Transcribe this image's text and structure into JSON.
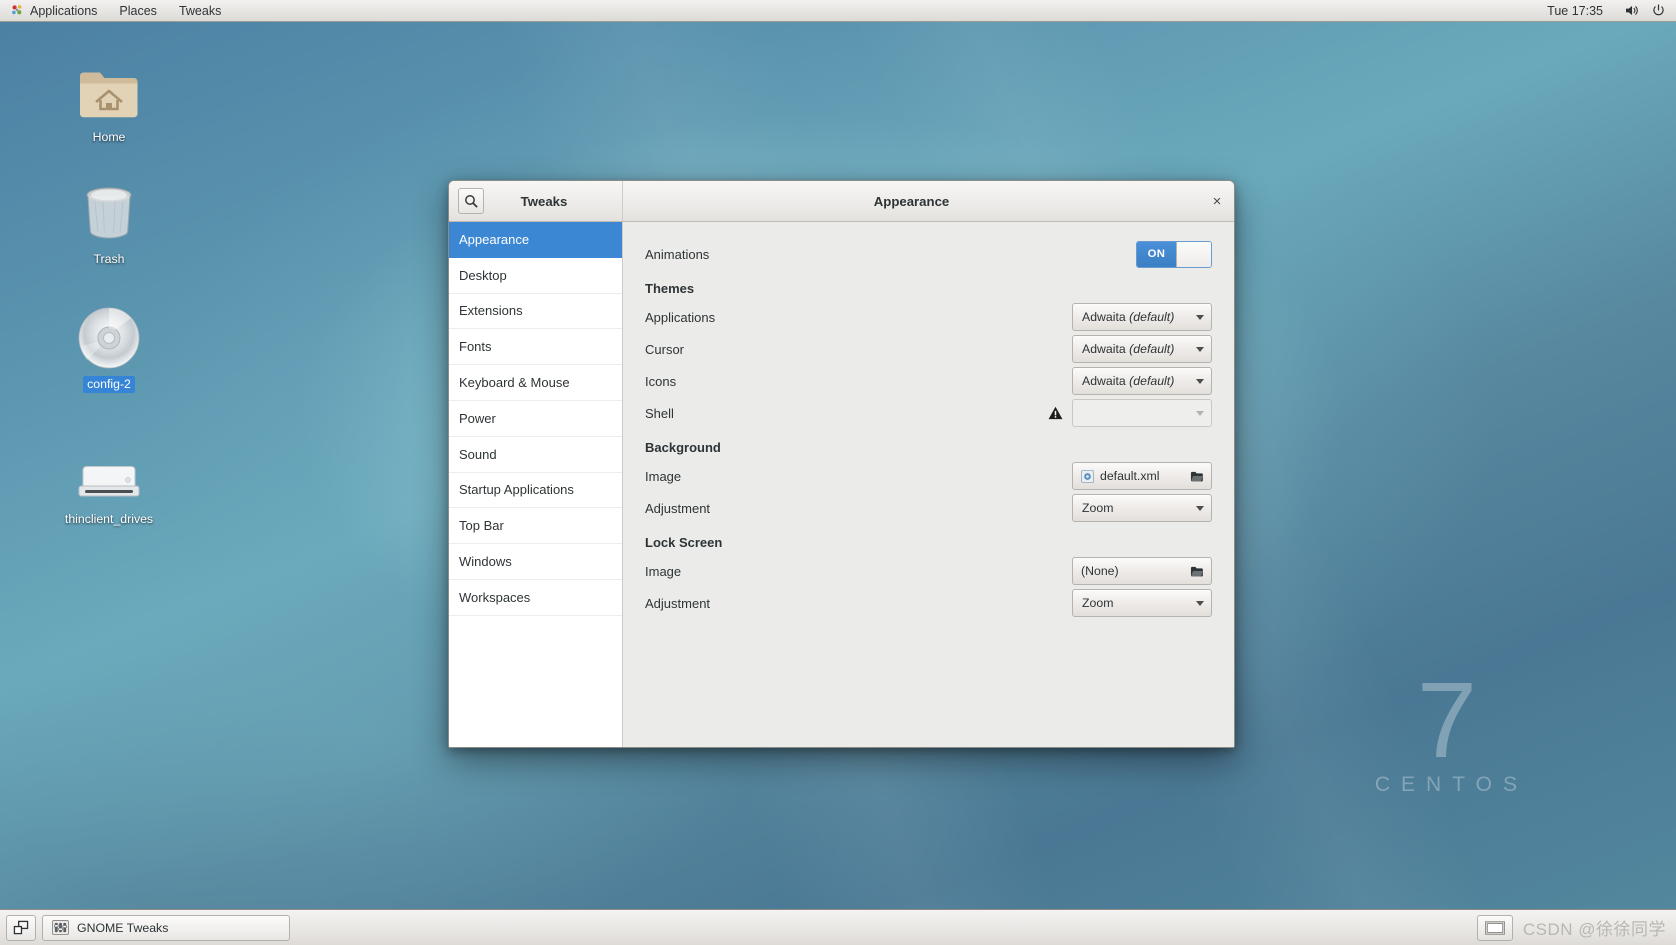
{
  "topbar": {
    "activities_label": "Applications",
    "places_label": "Places",
    "app_label": "Tweaks",
    "clock": "Tue 17:35",
    "volume_icon": "speaker-icon",
    "power_icon": "power-icon",
    "gnome_icon": "gnome-logo-icon"
  },
  "desktop": {
    "icons": [
      {
        "label": "Home",
        "icon": "home-folder-icon",
        "selected": false
      },
      {
        "label": "Trash",
        "icon": "trash-icon",
        "selected": false
      },
      {
        "label": "config-2",
        "icon": "cdrom-icon",
        "selected": true
      },
      {
        "label": "thinclient_drives",
        "icon": "drive-icon",
        "selected": false
      }
    ],
    "wallpaper_mark": {
      "number": "7",
      "word": "CENTOS"
    }
  },
  "window": {
    "title": "Tweaks",
    "subtitle": "Appearance",
    "search_icon": "search-icon",
    "close_label": "×",
    "sidebar": [
      {
        "label": "Appearance",
        "active": true
      },
      {
        "label": "Desktop",
        "active": false
      },
      {
        "label": "Extensions",
        "active": false
      },
      {
        "label": "Fonts",
        "active": false
      },
      {
        "label": "Keyboard & Mouse",
        "active": false
      },
      {
        "label": "Power",
        "active": false
      },
      {
        "label": "Sound",
        "active": false
      },
      {
        "label": "Startup Applications",
        "active": false
      },
      {
        "label": "Top Bar",
        "active": false
      },
      {
        "label": "Windows",
        "active": false
      },
      {
        "label": "Workspaces",
        "active": false
      }
    ],
    "content": {
      "animations": {
        "label": "Animations",
        "toggle_state": "ON"
      },
      "themes_heading": "Themes",
      "themes": {
        "applications": {
          "label": "Applications",
          "value_prefix": "Adwaita ",
          "value_em": "(default)"
        },
        "cursor": {
          "label": "Cursor",
          "value_prefix": "Adwaita ",
          "value_em": "(default)"
        },
        "icons": {
          "label": "Icons",
          "value_prefix": "Adwaita ",
          "value_em": "(default)"
        },
        "shell": {
          "label": "Shell",
          "value": "",
          "warning_icon": "warning-triangle-icon",
          "disabled": true
        }
      },
      "background_heading": "Background",
      "background": {
        "image": {
          "label": "Image",
          "value": "default.xml",
          "file_icon": "xml-file-icon",
          "open_icon": "open-folder-icon"
        },
        "adjustment": {
          "label": "Adjustment",
          "value": "Zoom"
        }
      },
      "lockscreen_heading": "Lock Screen",
      "lockscreen": {
        "image": {
          "label": "Image",
          "value": "(None)",
          "open_icon": "open-folder-icon"
        },
        "adjustment": {
          "label": "Adjustment",
          "value": "Zoom"
        }
      }
    }
  },
  "taskbar": {
    "show_desktop_icon": "show-desktop-icon",
    "task_label": "GNOME Tweaks",
    "task_icon": "tweaks-app-icon",
    "workspace_icon": "workspace-switcher-icon",
    "watermark": "CSDN @徐徐同学"
  },
  "colors": {
    "accent": "#3c87d4",
    "toggle_on": "#4a90d9",
    "window_bg": "#ebebe9",
    "sidebar_bg": "#ffffff"
  }
}
